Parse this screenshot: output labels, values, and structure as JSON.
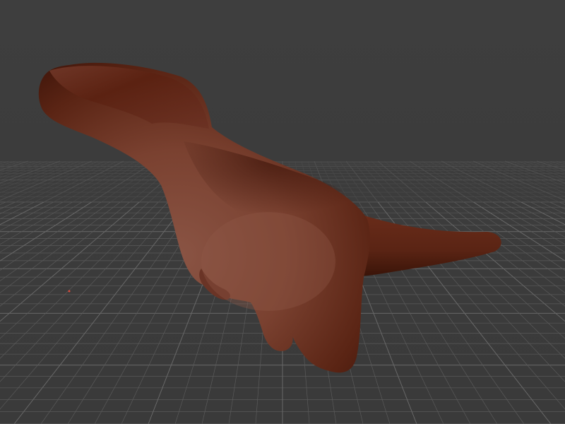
{
  "viewport": {
    "background_color": "#3c3c3c",
    "grid_color": "#5a5a5a",
    "grid_major_color": "#686868",
    "model": {
      "name_icon": "dinosaur-model",
      "color_light": "#8a4f3e",
      "color_mid": "#6d3424",
      "color_dark": "#3f150a"
    },
    "origin_marker_color": "#d84a3a"
  }
}
